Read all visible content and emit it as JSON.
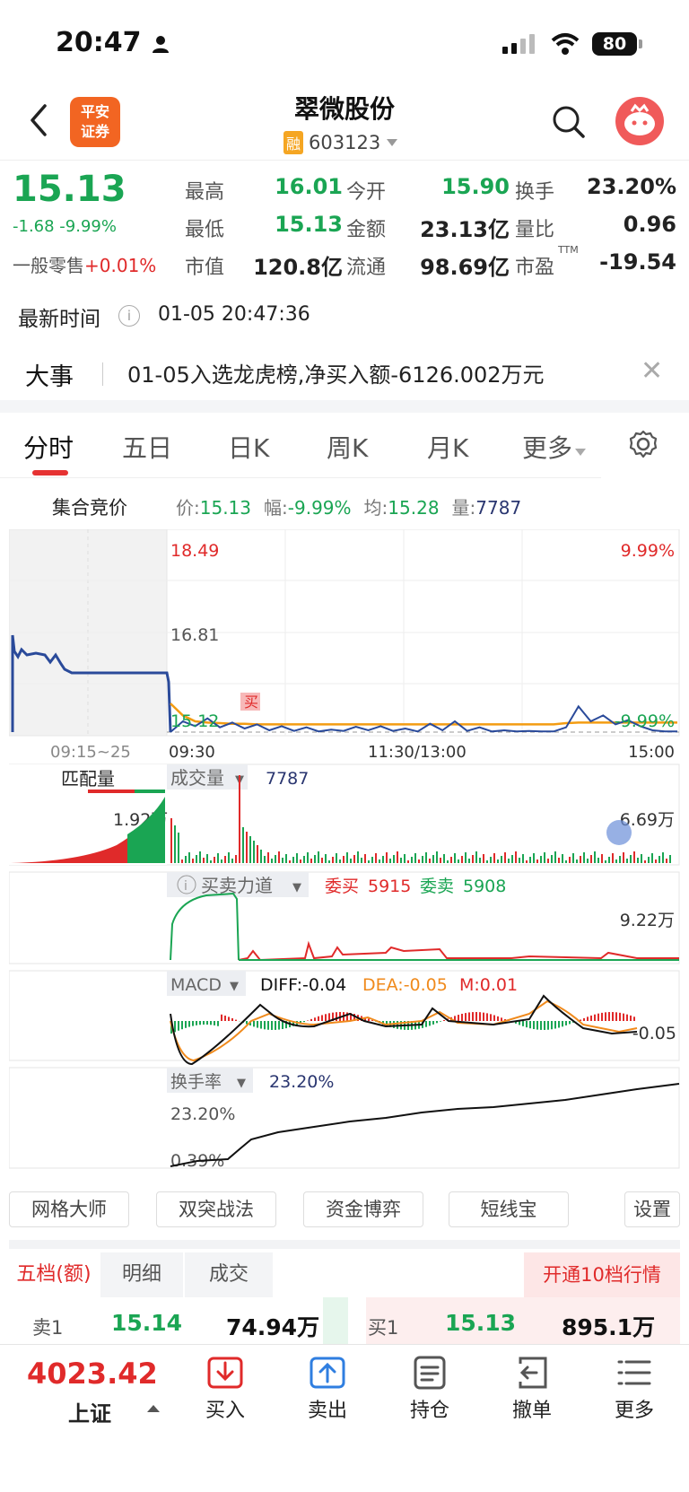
{
  "status_bar": {
    "time": "20:47",
    "battery": "80"
  },
  "header": {
    "stock_name": "翠微股份",
    "stock_code": "603123",
    "margin_badge": "融",
    "logo_line1": "平安",
    "logo_line2": "证券"
  },
  "quote": {
    "price": "15.13",
    "change": "-1.68 -9.99%",
    "retail_label": "一般零售",
    "retail_value": "+0.01%",
    "fields": [
      {
        "label": "最高",
        "value": "16.01",
        "color": "#1aa553"
      },
      {
        "label": "今开",
        "value": "15.90",
        "color": "#1aa553"
      },
      {
        "label": "换手",
        "value": "23.20%",
        "color": "#222222"
      },
      {
        "label": "最低",
        "value": "15.13",
        "color": "#1aa553"
      },
      {
        "label": "金额",
        "value": "23.13亿",
        "color": "#222222"
      },
      {
        "label": "量比",
        "value": "0.96",
        "color": "#222222"
      },
      {
        "label": "市值",
        "value": "120.8亿",
        "color": "#222222"
      },
      {
        "label": "流通",
        "value": "98.69亿",
        "color": "#222222"
      },
      {
        "label": "市盈",
        "value": "-19.54",
        "color": "#222222",
        "sup": "TTM"
      }
    ]
  },
  "update": {
    "label": "最新时间",
    "value": "01-05 20:47:36"
  },
  "event": {
    "label": "大事",
    "text": "01-05入选龙虎榜,净买入额-6126.002万元"
  },
  "tabs": [
    {
      "label": "分时",
      "active": true
    },
    {
      "label": "五日",
      "active": false
    },
    {
      "label": "日K",
      "active": false
    },
    {
      "label": "周K",
      "active": false
    },
    {
      "label": "月K",
      "active": false
    },
    {
      "label": "更多",
      "active": false
    }
  ],
  "summary": {
    "auction_label": "集合竞价",
    "price_k": "价:",
    "price_v": "15.13",
    "range_k": "幅:",
    "range_v": "-9.99%",
    "avg_k": "均:",
    "avg_v": "15.28",
    "vol_k": "量:",
    "vol_v": "7787"
  },
  "chart_data": {
    "type": "line",
    "price_axis": {
      "top": "18.49",
      "mid": "16.81",
      "bottom": "15.12",
      "top_pct": "9.99%",
      "bottom_pct": "-9.99%"
    },
    "time_labels": {
      "auction": "09:15~25",
      "open": "09:30",
      "mid": "11:30/13:00",
      "close": "15:00"
    },
    "buy_marker": "买",
    "price_series": [
      15.12,
      15.3,
      15.22,
      15.35,
      15.2,
      15.28,
      15.18,
      15.25,
      15.15,
      15.22,
      15.14,
      15.2,
      15.13,
      15.16,
      15.14,
      15.21,
      15.15,
      15.22,
      15.14,
      15.18,
      15.13,
      15.26,
      15.15,
      15.3,
      15.14,
      15.2,
      15.13,
      15.15,
      15.13,
      15.14,
      15.13,
      15.13,
      15.2,
      15.55,
      15.3,
      15.4,
      15.25,
      15.32,
      15.22,
      15.15,
      15.13,
      15.13
    ],
    "avg_series": [
      15.6,
      15.4,
      15.3,
      15.28,
      15.27,
      15.26,
      15.26,
      15.25,
      15.25,
      15.25,
      15.25,
      15.25,
      15.25,
      15.25,
      15.25,
      15.25,
      15.25,
      15.25,
      15.25,
      15.25,
      15.25,
      15.25,
      15.25,
      15.25,
      15.25,
      15.25,
      15.25,
      15.25,
      15.25,
      15.25,
      15.25,
      15.25,
      15.27,
      15.28,
      15.28,
      15.28,
      15.28,
      15.28,
      15.28,
      15.28,
      15.28,
      15.28
    ],
    "volume": {
      "label": "成交量",
      "value": "7787",
      "match_label": "匹配量",
      "match_max": "1.92万",
      "max": "6.69万"
    },
    "force": {
      "label": "买卖力道",
      "buy_label": "委买",
      "buy_value": "5915",
      "sell_label": "委卖",
      "sell_value": "5908",
      "max": "9.22万"
    },
    "macd": {
      "label": "MACD",
      "diff": "DIFF:-0.04",
      "dea": "DEA:-0.05",
      "m": "M:0.01",
      "axis": "-0.05"
    },
    "turnover": {
      "label": "换手率",
      "value": "23.20%",
      "top": "23.20%",
      "bottom": "0.39%"
    }
  },
  "strategies": [
    "网格大师",
    "双突战法",
    "资金博弈",
    "短线宝",
    "设置"
  ],
  "depth": {
    "tabs": [
      "五档(额)",
      "明细",
      "成交"
    ],
    "open10": "开通10档行情",
    "sell1_label": "卖1",
    "sell1_price": "15.14",
    "sell1_amount": "74.94万",
    "buy1_label": "买1",
    "buy1_price": "15.13",
    "buy1_amount": "895.1万"
  },
  "bottom": {
    "index_value": "4023.42",
    "index_name": "上证",
    "buttons": [
      {
        "label": "买入",
        "icon": "buy-icon"
      },
      {
        "label": "卖出",
        "icon": "sell-icon"
      },
      {
        "label": "持仓",
        "icon": "position-icon"
      },
      {
        "label": "撤单",
        "icon": "cancel-order-icon"
      },
      {
        "label": "更多",
        "icon": "more-icon"
      }
    ]
  }
}
